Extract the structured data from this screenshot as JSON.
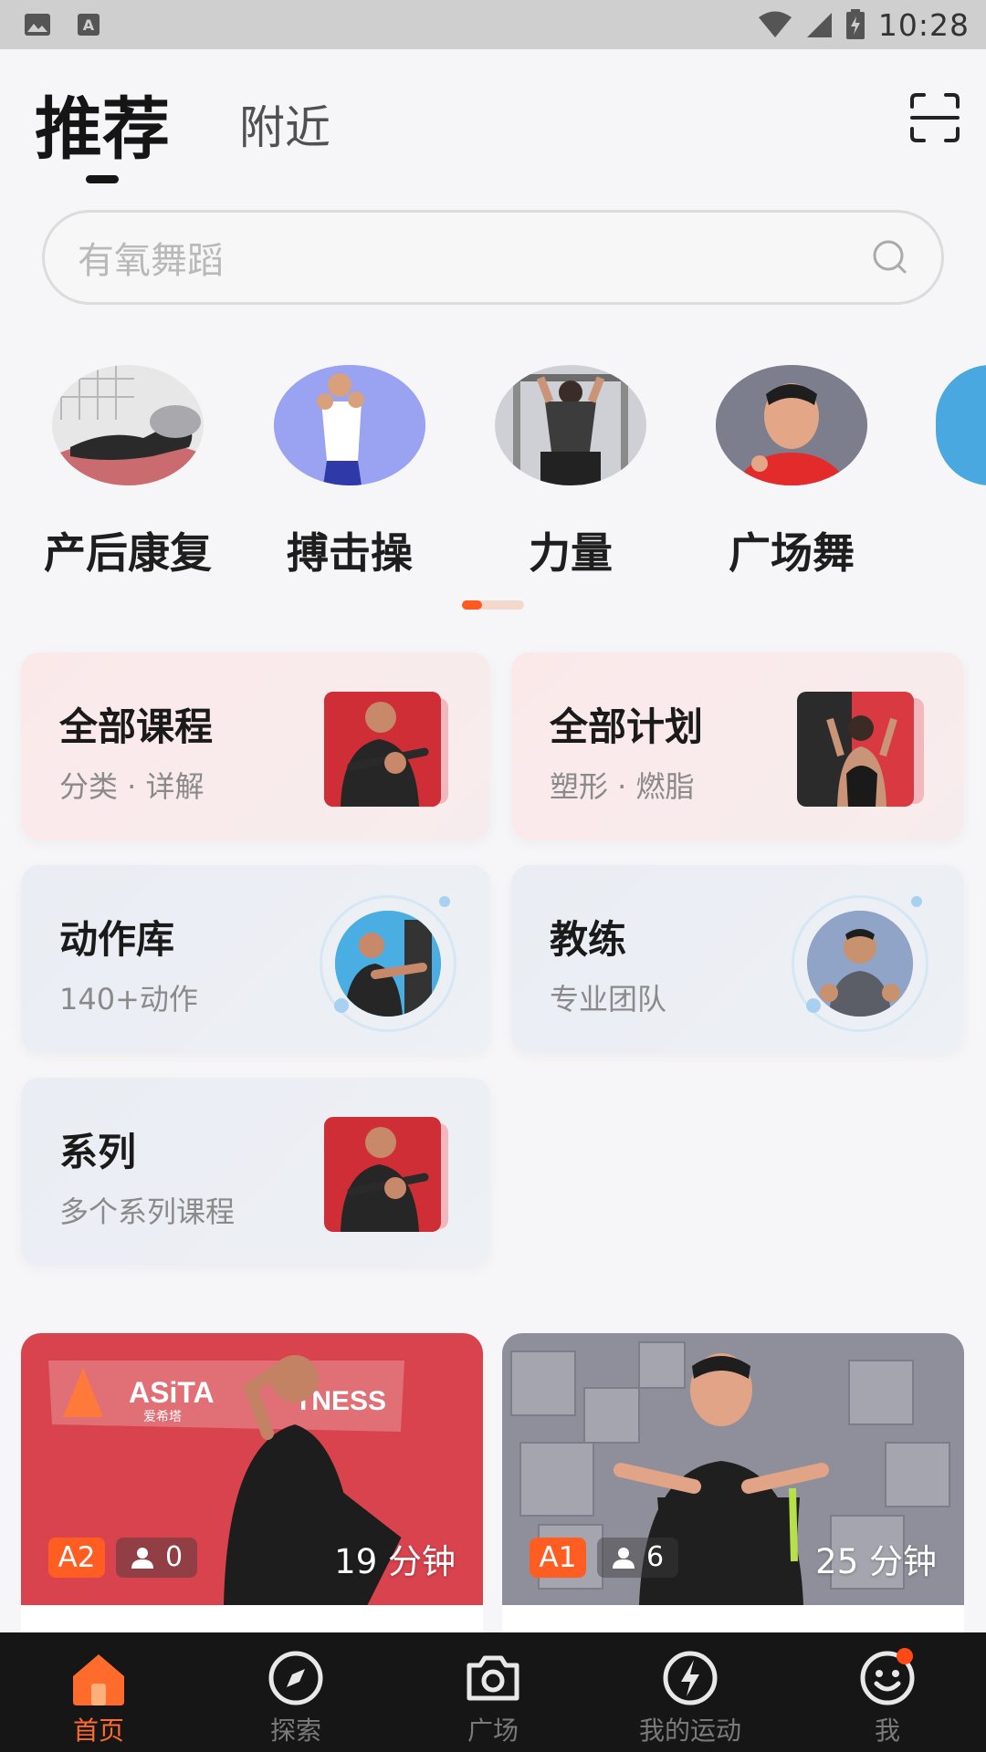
{
  "status_bar": {
    "time": "10:28"
  },
  "header": {
    "tab_recommend": "推荐",
    "tab_nearby": "附近"
  },
  "search": {
    "placeholder": "有氧舞蹈"
  },
  "categories": [
    {
      "label": "产后康复"
    },
    {
      "label": "搏击操"
    },
    {
      "label": "力量"
    },
    {
      "label": "广场舞"
    }
  ],
  "features": [
    {
      "title": "全部课程",
      "sub": "分类 · 详解"
    },
    {
      "title": "全部计划",
      "sub": "塑形 · 燃脂"
    },
    {
      "title": "动作库",
      "sub": "140+动作"
    },
    {
      "title": "教练",
      "sub": "专业团队"
    },
    {
      "title": "系列",
      "sub": "多个系列课程"
    }
  ],
  "courses": [
    {
      "level": "A2",
      "people": "0",
      "duration": "19 分钟",
      "banner_text": "ASiTA",
      "banner_sub": "爱希塔",
      "banner_text2": "TNESS"
    },
    {
      "level": "A1",
      "people": "6",
      "duration": "25 分钟"
    }
  ],
  "bottom_nav": [
    {
      "label": "首页",
      "icon": "home-icon",
      "active": true
    },
    {
      "label": "探索",
      "icon": "compass-icon"
    },
    {
      "label": "广场",
      "icon": "camera-icon"
    },
    {
      "label": "我的运动",
      "icon": "lightning-icon"
    },
    {
      "label": "我",
      "icon": "smiley-icon"
    }
  ],
  "colors": {
    "accent": "#ff5a1f",
    "nav_bg": "#161616",
    "card_pink": "#fbe9ea",
    "card_blue": "#eaedf3"
  }
}
